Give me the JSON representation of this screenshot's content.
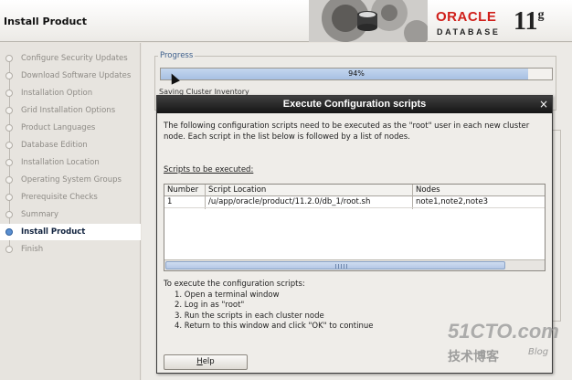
{
  "window": {
    "title": "Install Product"
  },
  "brand": {
    "oracle": "ORACLE",
    "database": "DATABASE",
    "version": "11",
    "version_sup": "g"
  },
  "sidebar": {
    "items": [
      {
        "label": "Configure Security Updates",
        "active": false
      },
      {
        "label": "Download Software Updates",
        "active": false
      },
      {
        "label": "Installation Option",
        "active": false
      },
      {
        "label": "Grid Installation Options",
        "active": false
      },
      {
        "label": "Product Languages",
        "active": false
      },
      {
        "label": "Database Edition",
        "active": false
      },
      {
        "label": "Installation Location",
        "active": false
      },
      {
        "label": "Operating System Groups",
        "active": false
      },
      {
        "label": "Prerequisite Checks",
        "active": false
      },
      {
        "label": "Summary",
        "active": false
      },
      {
        "label": "Install Product",
        "active": true
      },
      {
        "label": "Finish",
        "active": false
      }
    ]
  },
  "progress": {
    "legend": "Progress",
    "percent_label": "94%",
    "fraction": 0.94,
    "status": "Saving Cluster Inventory"
  },
  "dialog": {
    "title": "Execute Configuration scripts",
    "intro": "The following configuration scripts need to be executed as the \"root\" user in each new cluster node. Each script in the list below is followed by a list of nodes.",
    "scripts_label": "Scripts to be executed:",
    "table": {
      "headers": [
        "Number",
        "Script Location",
        "Nodes"
      ],
      "rows": [
        [
          "1",
          "/u/app/oracle/product/11.2.0/db_1/root.sh",
          "note1,note2,note3"
        ]
      ]
    },
    "instructions": {
      "heading": "To execute the configuration scripts:",
      "steps": [
        "1. Open a terminal window",
        "2. Log in as \"root\"",
        "3. Run the scripts in each cluster node",
        "4. Return to this window and click \"OK\" to continue"
      ]
    },
    "help_button": {
      "first": "H",
      "rest": "elp"
    }
  },
  "watermark": {
    "site": "51CTO.com",
    "cn": "技术博客",
    "blog": "Blog"
  },
  "colors": {
    "accent": "#5a8fd1",
    "oracle_red": "#d0201b",
    "titlebar": "#1f1f1f"
  }
}
